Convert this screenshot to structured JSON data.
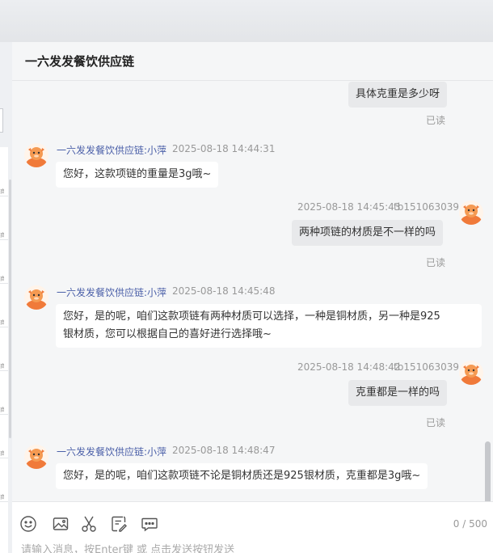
{
  "header": {
    "title": "一六发发餐饮供应链"
  },
  "messages": [
    {
      "direction": "out",
      "text": "具体克重是多少呀",
      "status": "已读"
    },
    {
      "direction": "in",
      "sender": "一六发发餐饮供应链:小萍",
      "time": "2025-08-18 14:44:31",
      "text": "您好，这款项链的重量是3g哦~"
    },
    {
      "direction": "out",
      "time": "2025-08-18 14:45:43",
      "sender": "tb151063039",
      "text": "两种项链的材质是不一样的吗",
      "status": "已读"
    },
    {
      "direction": "in",
      "sender": "一六发发餐饮供应链:小萍",
      "time": "2025-08-18 14:45:48",
      "text_line1": "您好，是的呢，咱们这款项链有两种材质可以选择，一种是铜材质，另一种是925",
      "text_line2": "银材质，您可以根据自己的喜好进行选择哦~"
    },
    {
      "direction": "out",
      "time": "2025-08-18 14:48:42",
      "sender": "tb151063039",
      "text": "克重都是一样的吗",
      "status": "已读"
    },
    {
      "direction": "in",
      "sender": "一六发发餐饮供应链:小萍",
      "time": "2025-08-18 14:48:47",
      "text": "您好，是的呢，咱们这款项链不论是铜材质还是925银材质，克重都是3g哦~"
    }
  ],
  "toolbar": {
    "icons": [
      "emoji-icon",
      "image-icon",
      "scissors-icon",
      "quick-reply-icon",
      "chat-bubble-icon"
    ],
    "counter": "0 / 500",
    "input_placeholder": "请输入消息，按Enter键 或 点击发送按钮发送"
  },
  "left_strip_marks": [
    "商",
    "商",
    "商",
    "商",
    "商",
    "商",
    "商",
    "商"
  ]
}
